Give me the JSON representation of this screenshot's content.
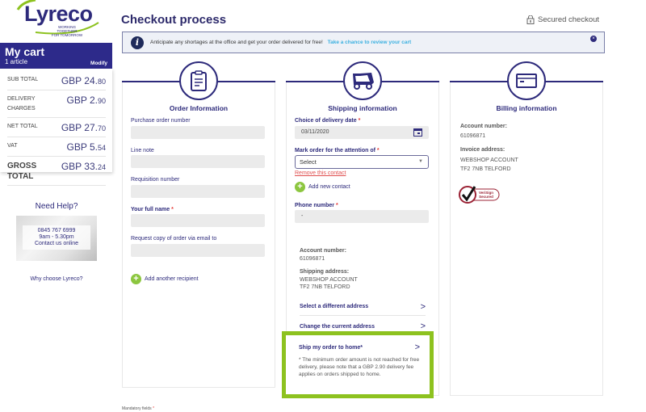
{
  "logo": {
    "name": "Lyreco",
    "tagline_1": "WORKING TOGETHER",
    "tagline_2": "FOR TOMORROW"
  },
  "cart": {
    "title": "My cart",
    "subtitle": "1 article",
    "modify_label": "Modify",
    "rows": [
      {
        "label": "SUB TOTAL",
        "value_main": "GBP 24.",
        "value_cents": "80"
      },
      {
        "label": "DELIVERY CHARGES",
        "value_main": "GBP 2.",
        "value_cents": "90"
      },
      {
        "label": "NET TOTAL",
        "value_main": "GBP 27.",
        "value_cents": "70"
      },
      {
        "label": "VAT",
        "value_main": "GBP 5.",
        "value_cents": "54"
      },
      {
        "label": "GROSS TOTAL",
        "value_main": "GBP 33.",
        "value_cents": "24"
      }
    ]
  },
  "help": {
    "title": "Need Help?",
    "phone": "0845 767 6999",
    "hours": "9am - 5.30pm",
    "contact_link": "Contact us online",
    "why_link": "Why choose Lyreco?"
  },
  "header": {
    "title": "Checkout process",
    "secured_label": "Secured checkout"
  },
  "banner": {
    "text": "Anticipate any shortages at the office and get your order delivered for free!",
    "link": "Take a chance to review your cart"
  },
  "order_info": {
    "title": "Order Information",
    "fields": {
      "po_number": {
        "label": "Purchase order number",
        "value": ""
      },
      "line_note": {
        "label": "Line note",
        "value": ""
      },
      "requisition": {
        "label": "Requisition number",
        "value": ""
      },
      "full_name": {
        "label": "Your full name",
        "value": ""
      },
      "email_copy": {
        "label": "Request copy of order via email to",
        "value": ""
      }
    },
    "add_recipient": "Add another recipient"
  },
  "shipping_info": {
    "title": "Shipping information",
    "delivery_date_label": "Choice of delivery date",
    "delivery_date_value": "03/11/2020",
    "attention_label": "Mark order for the attention of",
    "attention_value": "Select",
    "remove_contact": "Remove this contact",
    "add_contact": "Add new contact",
    "phone_label": "Phone number",
    "phone_value": "-",
    "account_label": "Account number:",
    "account_value": "61096871",
    "address_label": "Shipping address:",
    "address_line1": "WEBSHOP ACCOUNT",
    "address_line2": "TF2 7NB  TELFORD",
    "select_different": "Select a different address",
    "change_current": "Change the current address",
    "ship_home": "Ship my order to home*",
    "ship_home_note": "* The minimum order amount is not reached for free delivery, please note that a GBP 2.90 delivery fee applies on orders shipped to home."
  },
  "billing_info": {
    "title": "Billing information",
    "account_label": "Account number:",
    "account_value": "61096871",
    "invoice_label": "Invoice address:",
    "invoice_line1": "WEBSHOP ACCOUNT",
    "invoice_line2": "TF2 7NB  TELFORD",
    "verisign_1": "VeriSign",
    "verisign_2": "Secured"
  },
  "footer": {
    "mandatory": "Mandatory fields"
  },
  "colors": {
    "brand": "#2d2a7b",
    "accent_green": "#8dc21f",
    "required": "#e53935",
    "link": "#3bb0e0"
  }
}
